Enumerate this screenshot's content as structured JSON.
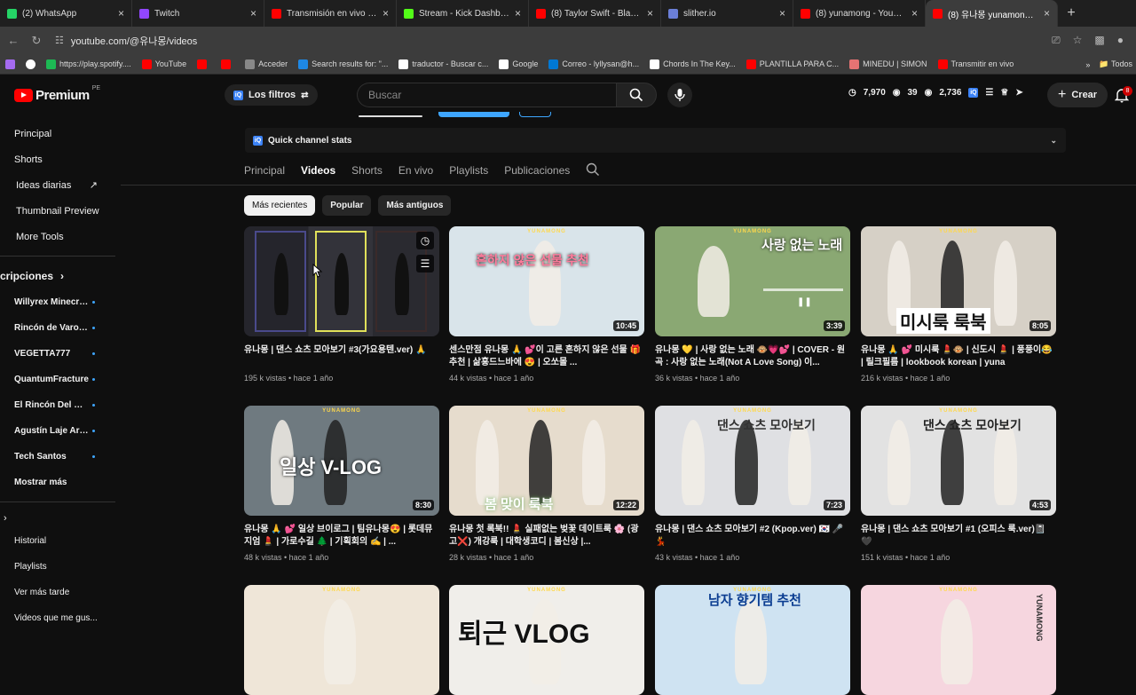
{
  "browser": {
    "tabs": [
      {
        "title": "(2) WhatsApp",
        "color": "#25d366"
      },
      {
        "title": "Twitch",
        "color": "#9146ff"
      },
      {
        "title": "Transmisión en vivo - You",
        "color": "#ff0000"
      },
      {
        "title": "Stream - Kick Dashboard",
        "color": "#53fc18"
      },
      {
        "title": "(8) Taylor Swift - Blank Sp",
        "color": "#ff0000"
      },
      {
        "title": "slither.io",
        "color": "#6b7fd7"
      },
      {
        "title": "(8) yunamong - YouTube",
        "color": "#ff0000"
      },
      {
        "title": "(8) 유나몽 yunamong_ - Y",
        "color": "#ff0000"
      }
    ],
    "url": "youtube.com/@유나몽/videos",
    "bookmarks": [
      {
        "label": "https://play.spotify....",
        "color": "#1db954"
      },
      {
        "label": "YouTube",
        "color": "#ff0000"
      },
      {
        "label": "",
        "color": "#ff0000"
      },
      {
        "label": "",
        "color": "#ff0000"
      },
      {
        "label": "Acceder",
        "color": "#888888"
      },
      {
        "label": "Search results for: \"...",
        "color": "#1e88e5"
      },
      {
        "label": "traductor - Buscar c...",
        "color": "#ffffff"
      },
      {
        "label": "Google",
        "color": "#ffffff"
      },
      {
        "label": "Correo - lyllysan@h...",
        "color": "#0078d4"
      },
      {
        "label": "Chords In The Key...",
        "color": "#ffffff"
      },
      {
        "label": "PLANTILLA PARA C...",
        "color": "#ff0000"
      },
      {
        "label": "MINEDU | SIMON",
        "color": "#e57373"
      },
      {
        "label": "Transmitir en vivo",
        "color": "#ff0000"
      }
    ],
    "bookmarks_more": "»",
    "bookmarks_folder": "Todos"
  },
  "header": {
    "logo_text": "Premium",
    "logo_region": "PE",
    "filters_label": "Los filtros",
    "search_placeholder": "Buscar",
    "stats": [
      "7,970",
      "39",
      "2,736"
    ],
    "create_label": "Crear",
    "notifications": "8"
  },
  "sidebar": {
    "main": [
      {
        "label": "Principal"
      },
      {
        "label": "Shorts"
      },
      {
        "label": "Ideas diarias",
        "external": true
      },
      {
        "label": "Thumbnail Preview"
      },
      {
        "label": "More Tools"
      }
    ],
    "subs_title": "cripciones",
    "subscriptions": [
      "Willyrex Minecraft",
      "Rincón de Varo - ...",
      "VEGETTA777",
      "QuantumFracture",
      "El Rincón Del Ma...",
      "Agustín Laje Arri...",
      "Tech Santos"
    ],
    "show_more": "Mostrar más",
    "library": [
      "Historial",
      "Playlists",
      "Ver más tarde",
      "Videos que me gus..."
    ]
  },
  "channel": {
    "quick_stats_label": "Quick channel stats",
    "tabs": [
      "Principal",
      "Videos",
      "Shorts",
      "En vivo",
      "Playlists",
      "Publicaciones"
    ],
    "active_tab": "Videos",
    "chips": [
      "Más recientes",
      "Popular",
      "Más antiguos"
    ]
  },
  "videos": [
    {
      "title": "유나몽 | 댄스 쇼츠 모아보기 #3(가요용텐.ver) 🙏",
      "meta": "195 k vistas • hace 1 año",
      "duration": "",
      "bg": "#2a2a2e"
    },
    {
      "title": "센스만점 유나몽 🙏 💕이 고른 흔하지 않은 선물 🎁 추천 | 삶흥드느바에 😍 | 오쏘몰 ...",
      "meta": "44 k vistas • hace 1 año",
      "duration": "10:45",
      "bg": "#d9e4ea",
      "overlay": "흔하지 않은 선물 추천"
    },
    {
      "title": "유나몽 💛 | 사랑 없는 노래 🐵💗💕 | COVER - 원곡 : 사랑 없는 노래(Not A Love Song) 이...",
      "meta": "36 k vistas • hace 1 año",
      "duration": "3:39",
      "bg": "#8aa873",
      "overlay": "사랑 없는 노래"
    },
    {
      "title": "유나몽 🙏 💕 미시룩 💄🐵 | 신도시 💄 | 풍풍이😂 | 릴크필름 | lookbook korean | yuna",
      "meta": "216 k vistas • hace 1 año",
      "duration": "8:05",
      "bg": "#d6d0c6",
      "overlay": "미시룩 룩북"
    },
    {
      "title": "유나몽 🙏 💕 일상 브이로그 | 팀유나몽😍 | 롯데뮤지엄 💄 | 가로수길 🌲 | 기획회의 ✍ | ...",
      "meta": "48 k vistas • hace 1 año",
      "duration": "8:30",
      "bg": "#6f7a80",
      "overlay": "일상 V-LOG"
    },
    {
      "title": "유나몽 첫 록북!! 💄 실패없는 벚꽃 데이트룩 🌸 (광고❌) 개강룩 | 대학생코디 | 봄신상 |...",
      "meta": "28 k vistas • hace 1 año",
      "duration": "12:22",
      "bg": "#e6dccd",
      "overlay": "봄 맞이 룩북"
    },
    {
      "title": "유나몽 | 댄스 쇼츠 모아보기 #2 (Kpop.ver) 🇰🇷 🎤💃",
      "meta": "43 k vistas • hace 1 año",
      "duration": "7:23",
      "bg": "#dfe0e3",
      "overlay": "댄스 쇼츠 모아보기"
    },
    {
      "title": "유나몽 | 댄스 쇼츠 모아보기 #1 (오피스 룩.ver)📓🖤",
      "meta": "151 k vistas • hace 1 año",
      "duration": "4:53",
      "bg": "#e2e2e2",
      "overlay": "댄스 쇼츠 모아보기"
    },
    {
      "title": "",
      "meta": "",
      "duration": "",
      "bg": "#efe6d8",
      "overlay": ""
    },
    {
      "title": "",
      "meta": "",
      "duration": "",
      "bg": "#f0eeea",
      "overlay": "퇴근 VLOG"
    },
    {
      "title": "",
      "meta": "",
      "duration": "",
      "bg": "#cfe3f2",
      "overlay": "남자 향기템 추천"
    },
    {
      "title": "",
      "meta": "",
      "duration": "",
      "bg": "#f6d6df",
      "overlay": "YUNAMONG"
    }
  ],
  "thumb_channel_tag": "YUNAMONG"
}
